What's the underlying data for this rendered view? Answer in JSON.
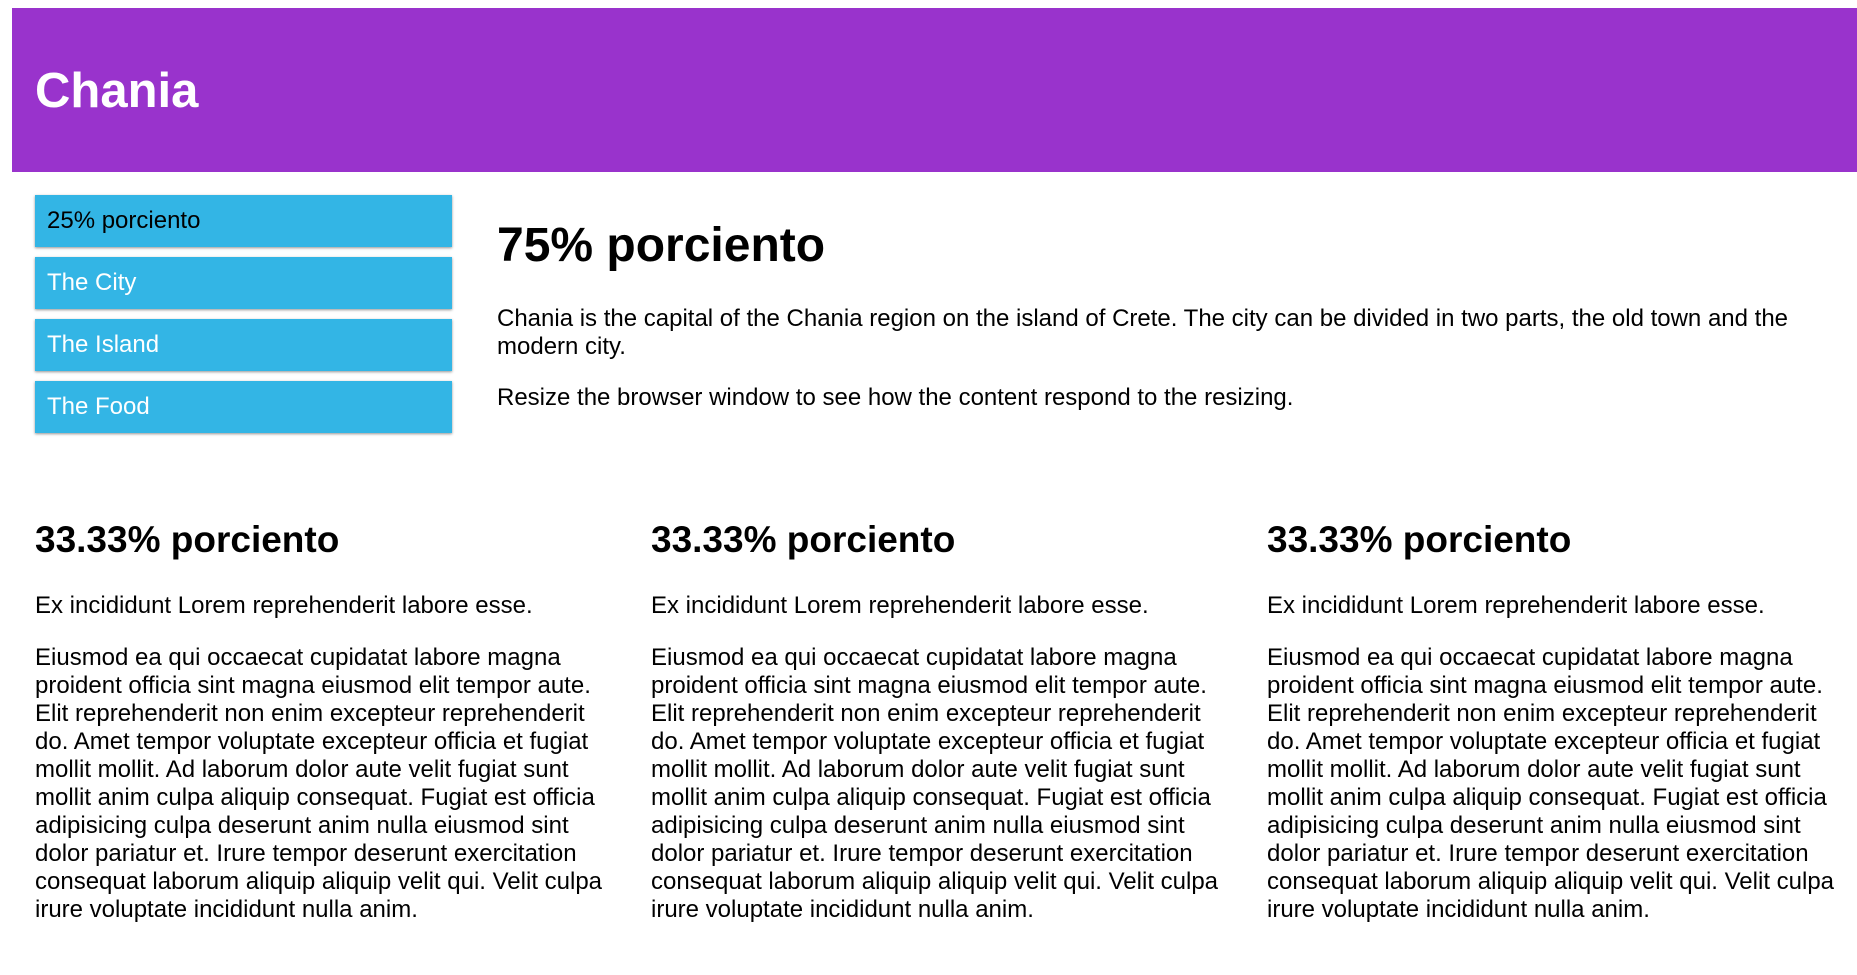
{
  "header": {
    "title": "Chania"
  },
  "colors": {
    "header_bg": "#9933cc",
    "menu_bg": "#33b5e5"
  },
  "menu": {
    "items": [
      {
        "label": "25% porciento"
      },
      {
        "label": "The City"
      },
      {
        "label": "The Island"
      },
      {
        "label": "The Food"
      }
    ]
  },
  "main": {
    "heading": "75% porciento",
    "paragraph1": "Chania is the capital of the Chania region on the island of Crete. The city can be divided in two parts, the old town and the modern city.",
    "paragraph2": "Resize the browser window to see how the content respond to the resizing."
  },
  "columns": [
    {
      "heading": "33.33% porciento",
      "lead": "Ex incididunt Lorem reprehenderit labore esse.",
      "body": "Eiusmod ea qui occaecat cupidatat labore magna proident officia sint magna eiusmod elit tempor aute. Elit reprehenderit non enim excepteur reprehenderit do. Amet tempor voluptate excepteur officia et fugiat mollit mollit. Ad laborum dolor aute velit fugiat sunt mollit anim culpa aliquip consequat. Fugiat est officia adipisicing culpa deserunt anim nulla eiusmod sint dolor pariatur et. Irure tempor deserunt exercitation consequat laborum aliquip aliquip velit qui. Velit culpa irure voluptate incididunt nulla anim."
    },
    {
      "heading": "33.33% porciento",
      "lead": "Ex incididunt Lorem reprehenderit labore esse.",
      "body": "Eiusmod ea qui occaecat cupidatat labore magna proident officia sint magna eiusmod elit tempor aute. Elit reprehenderit non enim excepteur reprehenderit do. Amet tempor voluptate excepteur officia et fugiat mollit mollit. Ad laborum dolor aute velit fugiat sunt mollit anim culpa aliquip consequat. Fugiat est officia adipisicing culpa deserunt anim nulla eiusmod sint dolor pariatur et. Irure tempor deserunt exercitation consequat laborum aliquip aliquip velit qui. Velit culpa irure voluptate incididunt nulla anim."
    },
    {
      "heading": "33.33% porciento",
      "lead": "Ex incididunt Lorem reprehenderit labore esse.",
      "body": "Eiusmod ea qui occaecat cupidatat labore magna proident officia sint magna eiusmod elit tempor aute. Elit reprehenderit non enim excepteur reprehenderit do. Amet tempor voluptate excepteur officia et fugiat mollit mollit. Ad laborum dolor aute velit fugiat sunt mollit anim culpa aliquip consequat. Fugiat est officia adipisicing culpa deserunt anim nulla eiusmod sint dolor pariatur et. Irure tempor deserunt exercitation consequat laborum aliquip aliquip velit qui. Velit culpa irure voluptate incididunt nulla anim."
    }
  ]
}
